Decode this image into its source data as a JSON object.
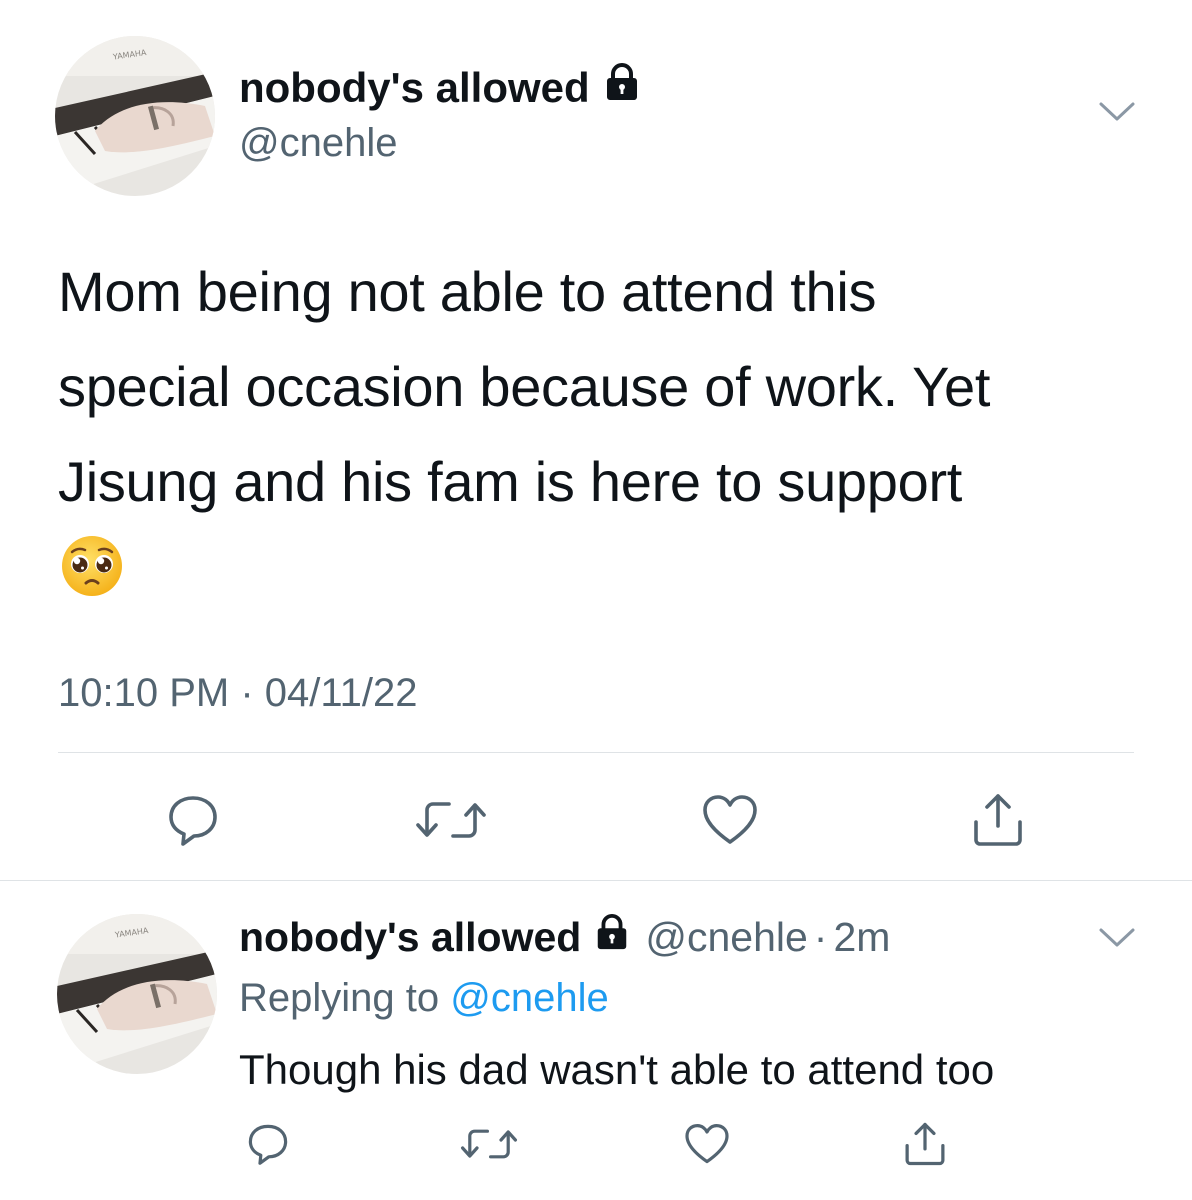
{
  "main_tweet": {
    "display_name": "nobody's allowed",
    "handle": "@cnehle",
    "text": "Mom being not able to attend this\nspecial occasion because of work. Yet\nJisung and his fam is here to support",
    "emoji": "pleading-face",
    "time": "10:10 PM",
    "meta_separator": "·",
    "date": "04/11/22",
    "protected_icon": "lock-icon",
    "actions": [
      "reply-icon",
      "retweet-icon",
      "like-icon",
      "share-icon"
    ]
  },
  "reply": {
    "display_name": "nobody's allowed",
    "handle": "@cnehle",
    "separator": "·",
    "relative_time": "2m",
    "replying_prefix": "Replying to",
    "replying_to": "@cnehle",
    "text": "Though his dad wasn't able to attend too",
    "protected_icon": "lock-icon",
    "actions": [
      "reply-icon",
      "retweet-icon",
      "like-icon",
      "share-icon"
    ]
  },
  "colors": {
    "text": "#0f1419",
    "secondary": "#536471",
    "link": "#1d9bf0",
    "divider": "#dfe3e6"
  }
}
